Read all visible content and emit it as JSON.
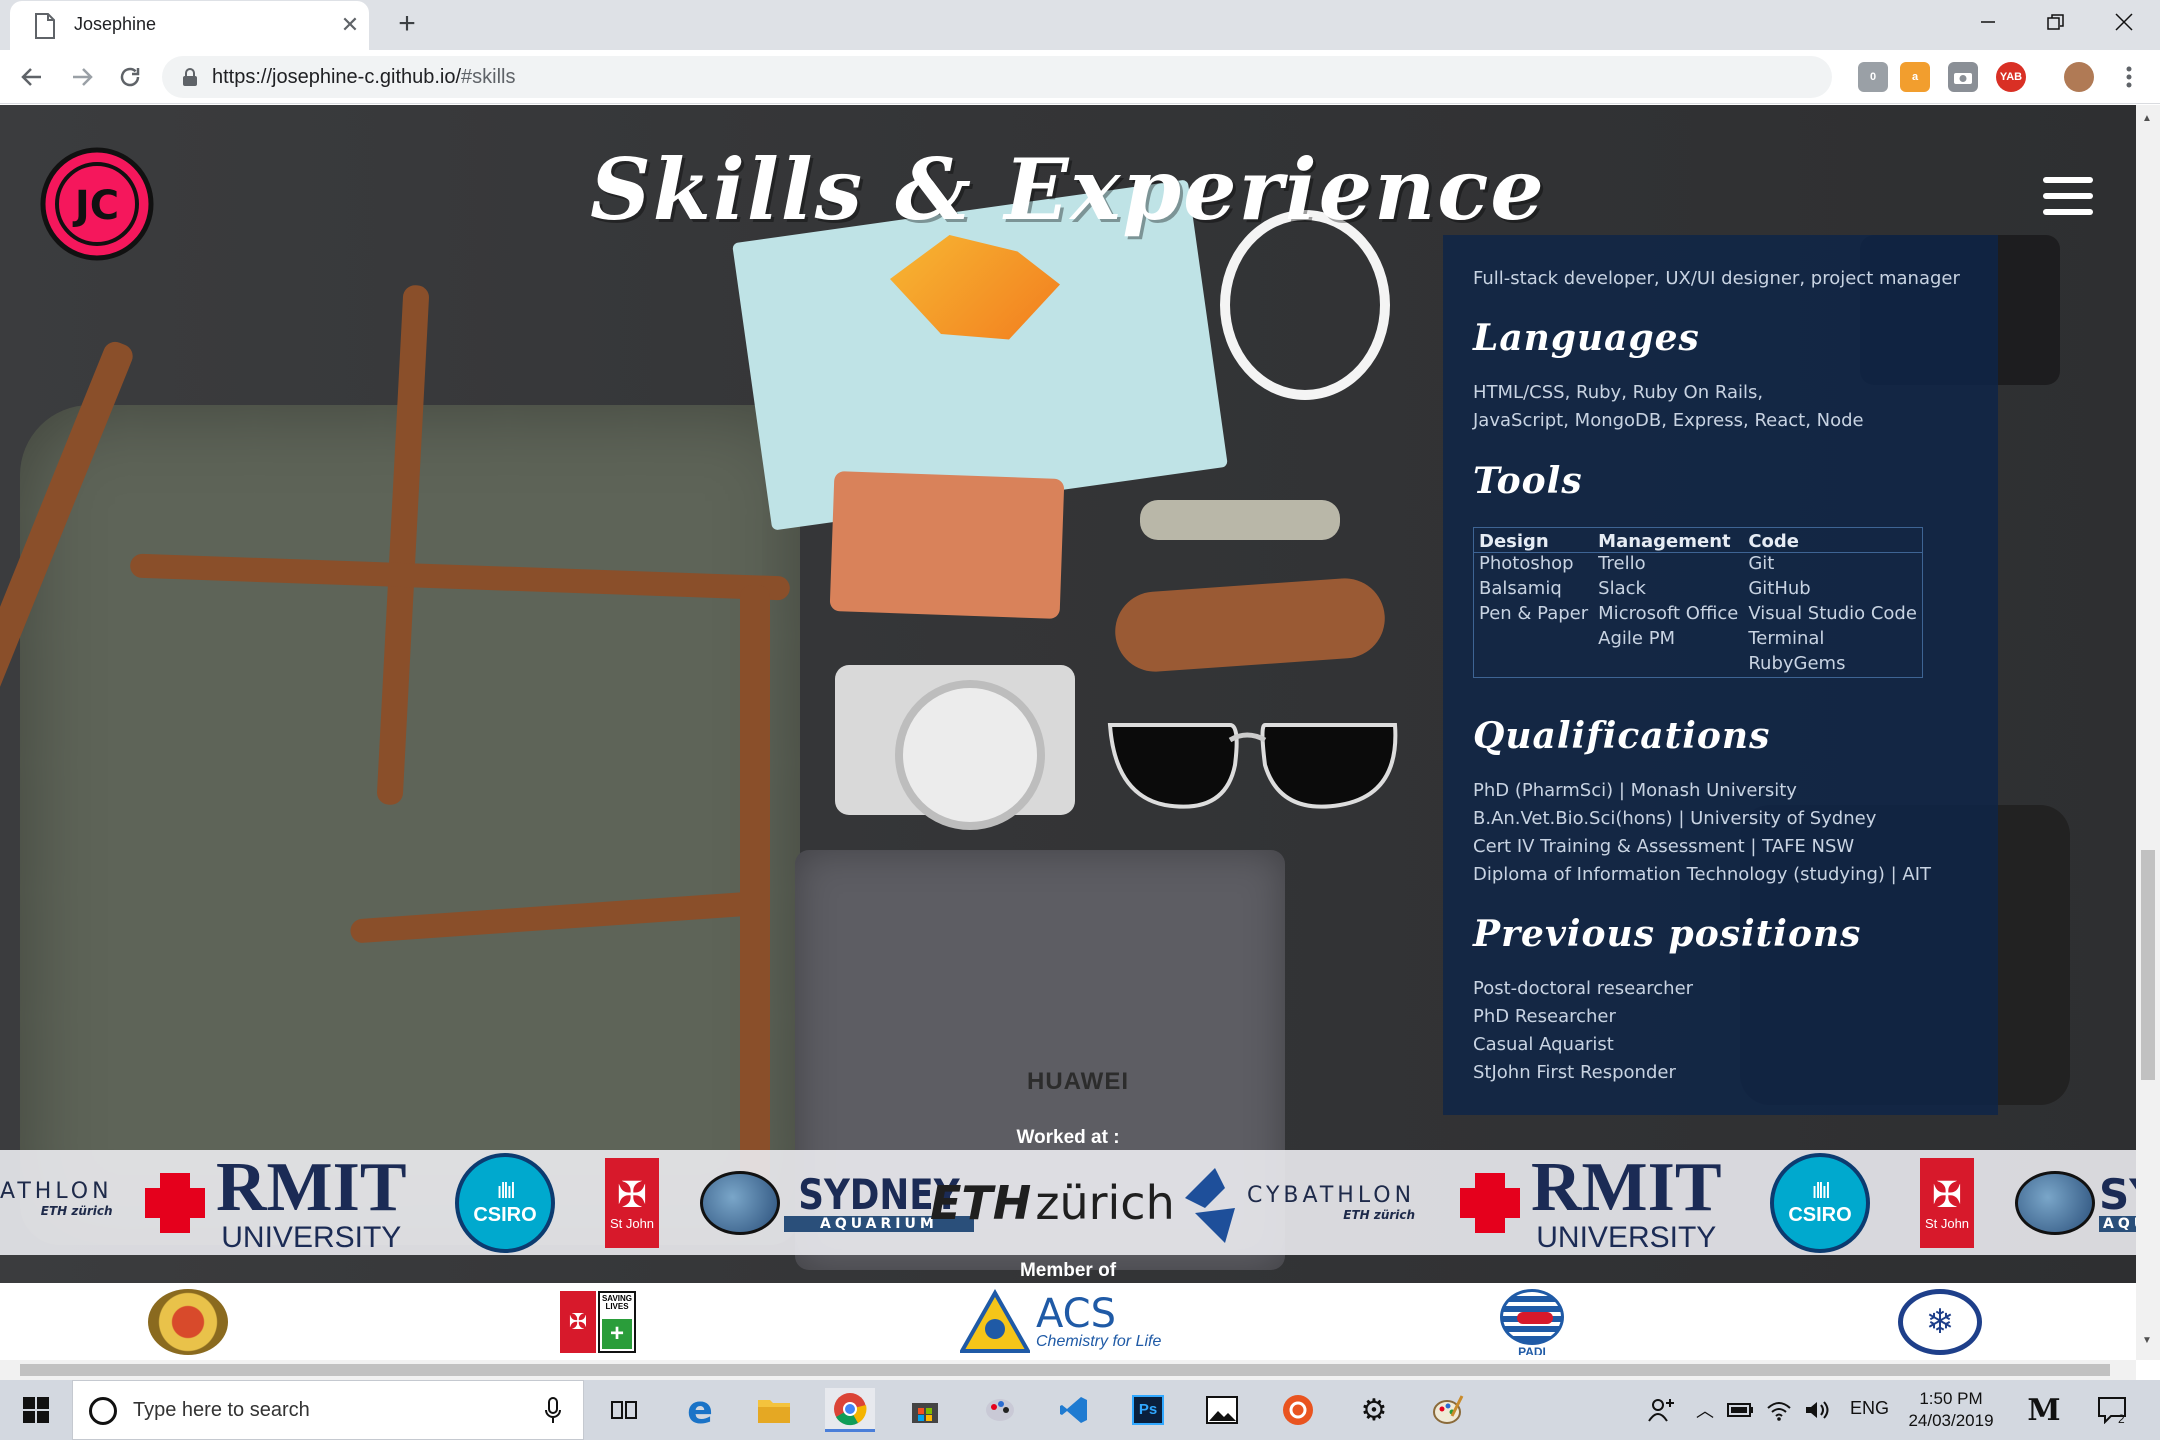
{
  "browser": {
    "tab_title": "Josephine",
    "new_tab_glyph": "+",
    "tab_close_glyph": "✕",
    "url_host": "https://josephine-c.github.io/",
    "url_rest": "#skills",
    "bookmark_glyph": "☆",
    "extensions": [
      {
        "name": "notes-extension-icon",
        "label": "0",
        "color": "#9aa0a6"
      },
      {
        "name": "amazon-extension-icon",
        "label": "a",
        "color": "#f29e2e"
      },
      {
        "name": "camera-extension-icon",
        "label": "",
        "color": "#8a8f96"
      },
      {
        "name": "yab-extension-icon",
        "label": "YAB",
        "color": "#d93025"
      }
    ]
  },
  "header": {
    "logo_text": "JC",
    "title": "Skills & Experience"
  },
  "photo": {
    "laptop_brand": "HUAWEI"
  },
  "skills": {
    "intro": "Full-stack developer, UX/UI designer, project manager",
    "languages_title": "Languages",
    "languages_line1": "HTML/CSS, Ruby, Ruby On Rails,",
    "languages_line2": "JavaScript, MongoDB, Express, React, Node",
    "tools_title": "Tools",
    "tools_headers": [
      "Design",
      "Management",
      "Code"
    ],
    "tools_rows": [
      [
        "Photoshop",
        "Trello",
        "Git"
      ],
      [
        "Balsamiq",
        "Slack",
        "GitHub"
      ],
      [
        "Pen & Paper",
        "Microsoft Office",
        "Visual Studio Code"
      ],
      [
        "",
        "Agile PM",
        "Terminal"
      ],
      [
        "",
        "",
        "RubyGems"
      ]
    ],
    "qualifications_title": "Qualifications",
    "qualifications": [
      "PhD (PharmSci) | Monash University",
      "B.An.Vet.Bio.Sci(hons) | University of Sydney",
      "Cert IV Training & Assessment | TAFE NSW",
      "Diploma of Information Technology (studying) | AIT"
    ],
    "positions_title": "Previous positions",
    "positions": [
      "Post-doctoral researcher",
      "PhD Researcher",
      "Casual Aquarist",
      "StJohn First Responder"
    ]
  },
  "worked_at": {
    "label": "Worked at :",
    "cybathlon_partial": "ATHLON",
    "eth_small": "ETH zürich",
    "rmit_big": "RMIT",
    "rmit_small": "UNIVERSITY",
    "csiro": "CSIRO",
    "stjohn": "St John",
    "sydney_big": "SYDNEY",
    "sydney_small": "AQUARIUM",
    "eth_big_a": "ETH",
    "eth_big_b": "zürich",
    "cybathlon": "CYBATHLON",
    "sydney_partial": "SY",
    "sydney_small_partial": "AQU"
  },
  "member_of": {
    "label": "Member of",
    "saving_lives": "SAVING LIVES",
    "acs_big": "ACS",
    "acs_small": "Chemistry for Life",
    "padi": "PADI"
  },
  "taskbar": {
    "search_placeholder": "Type here to search",
    "language": "ENG",
    "time": "1:50 PM",
    "date": "24/03/2019",
    "notifications": "2"
  }
}
